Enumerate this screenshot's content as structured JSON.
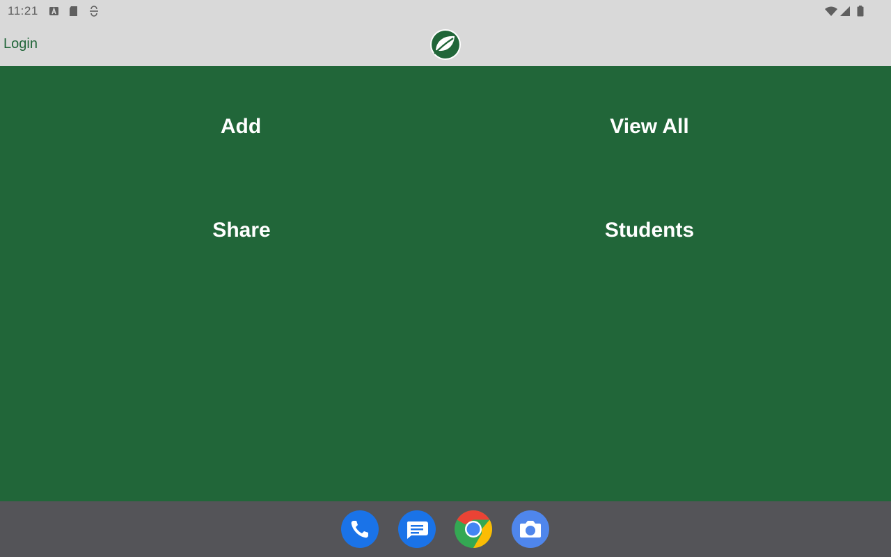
{
  "status_bar": {
    "time": "11:21",
    "icons": [
      "keyboard-a-icon",
      "sd-card-icon",
      "sync-icon",
      "wifi-icon",
      "cell-signal-icon",
      "battery-icon"
    ]
  },
  "app_bar": {
    "login_label": "Login",
    "logo_icon": "leaf-logo-icon",
    "accent_color": "#216639"
  },
  "main": {
    "background_color": "#216639",
    "buttons": [
      {
        "label": "Add"
      },
      {
        "label": "View All"
      },
      {
        "label": "Share"
      },
      {
        "label": "Students"
      }
    ]
  },
  "dock": {
    "apps": [
      "phone-icon",
      "messages-icon",
      "chrome-icon",
      "camera-icon"
    ]
  }
}
